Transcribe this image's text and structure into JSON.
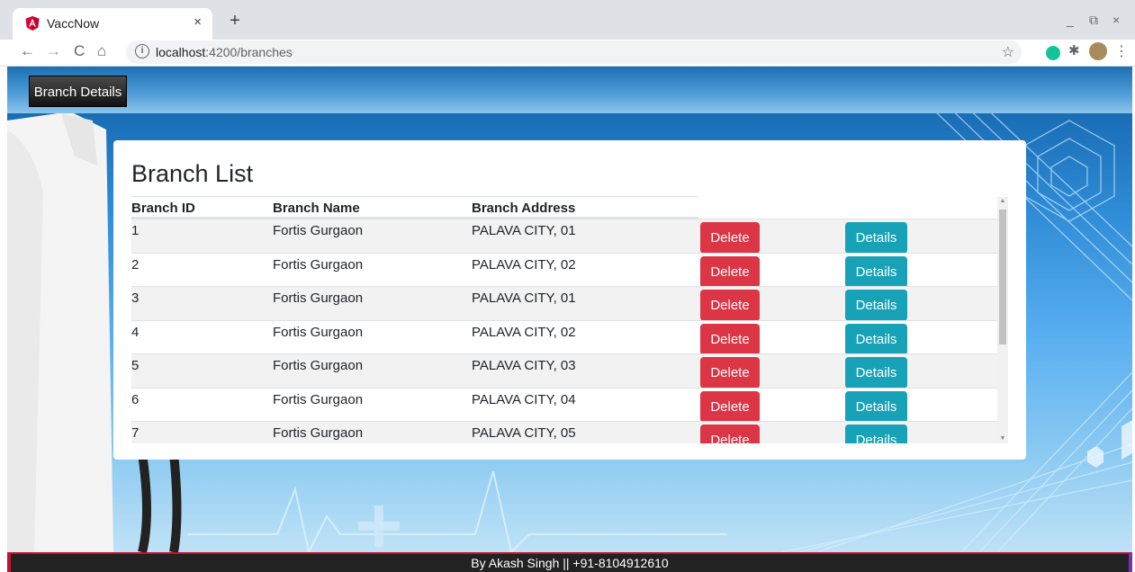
{
  "browser": {
    "tab_title": "VaccNow",
    "url_host": "localhost",
    "url_path": ":4200/branches",
    "info_glyph": "i",
    "close_glyph": "×",
    "newtab_glyph": "+",
    "back_glyph": "←",
    "forward_glyph": "→",
    "reload_glyph": "C",
    "home_glyph": "⌂",
    "star_glyph": "☆",
    "menu_glyph": "⋮",
    "minimize_glyph": "_",
    "restore_glyph": "⧉",
    "window_close_glyph": "×",
    "extension_glyph": "✱"
  },
  "navbar": {
    "branch_details_label": "Branch Details"
  },
  "card": {
    "title": "Branch List",
    "columns": [
      "Branch ID",
      "Branch Name",
      "Branch Address"
    ],
    "delete_label": "Delete",
    "details_label": "Details",
    "rows": [
      {
        "id": "1",
        "name": "Fortis Gurgaon",
        "address": "PALAVA CITY, 01"
      },
      {
        "id": "2",
        "name": "Fortis Gurgaon",
        "address": "PALAVA CITY, 02"
      },
      {
        "id": "3",
        "name": "Fortis Gurgaon",
        "address": "PALAVA CITY, 01"
      },
      {
        "id": "4",
        "name": "Fortis Gurgaon",
        "address": "PALAVA CITY, 02"
      },
      {
        "id": "5",
        "name": "Fortis Gurgaon",
        "address": "PALAVA CITY, 03"
      },
      {
        "id": "6",
        "name": "Fortis Gurgaon",
        "address": "PALAVA CITY, 04"
      },
      {
        "id": "7",
        "name": "Fortis Gurgaon",
        "address": "PALAVA CITY, 05"
      }
    ]
  },
  "footer": {
    "text": "By Akash Singh || +91-8104912610"
  },
  "colors": {
    "delete": "#dc3545",
    "details": "#17a2b8",
    "footer_bg": "#222222",
    "footer_accent": "#c8102e"
  }
}
